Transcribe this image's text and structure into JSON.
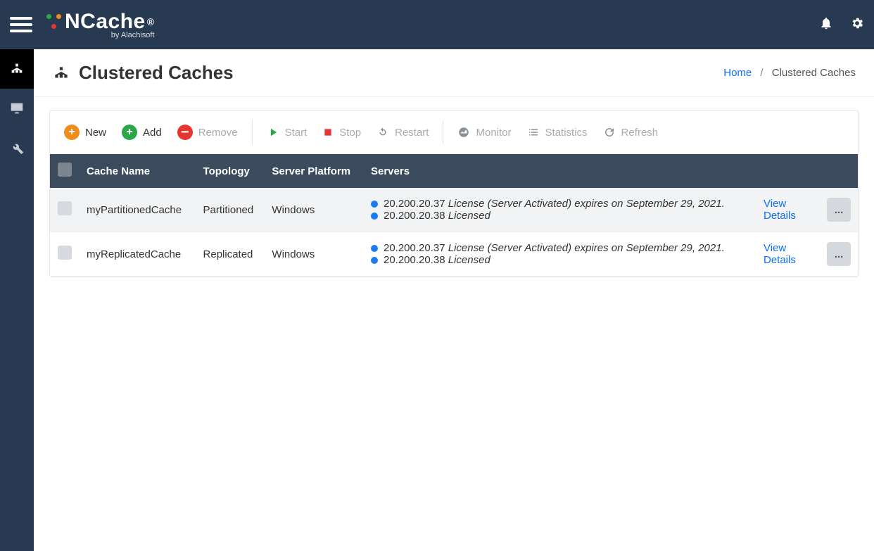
{
  "brand": {
    "name": "NCache",
    "byline": "by Alachisoft"
  },
  "breadcrumb": {
    "home": "Home",
    "current": "Clustered Caches"
  },
  "page_title": "Clustered Caches",
  "toolbar": {
    "new": "New",
    "add": "Add",
    "remove": "Remove",
    "start": "Start",
    "stop": "Stop",
    "restart": "Restart",
    "monitor": "Monitor",
    "statistics": "Statistics",
    "refresh": "Refresh"
  },
  "columns": {
    "cache_name": "Cache Name",
    "topology": "Topology",
    "server_platform": "Server Platform",
    "servers": "Servers"
  },
  "actions": {
    "view_details": "View Details",
    "more": "..."
  },
  "rows": [
    {
      "name": "myPartitionedCache",
      "topology": "Partitioned",
      "platform": "Windows",
      "s1_ip": "20.200.20.37",
      "s1_status": "License (Server Activated) expires on September 29, 2021.",
      "s2_ip": "20.200.20.38",
      "s2_status": "Licensed"
    },
    {
      "name": "myReplicatedCache",
      "topology": "Replicated",
      "platform": "Windows",
      "s1_ip": "20.200.20.37",
      "s1_status": "License (Server Activated) expires on September 29, 2021.",
      "s2_ip": "20.200.20.38",
      "s2_status": "Licensed"
    }
  ]
}
